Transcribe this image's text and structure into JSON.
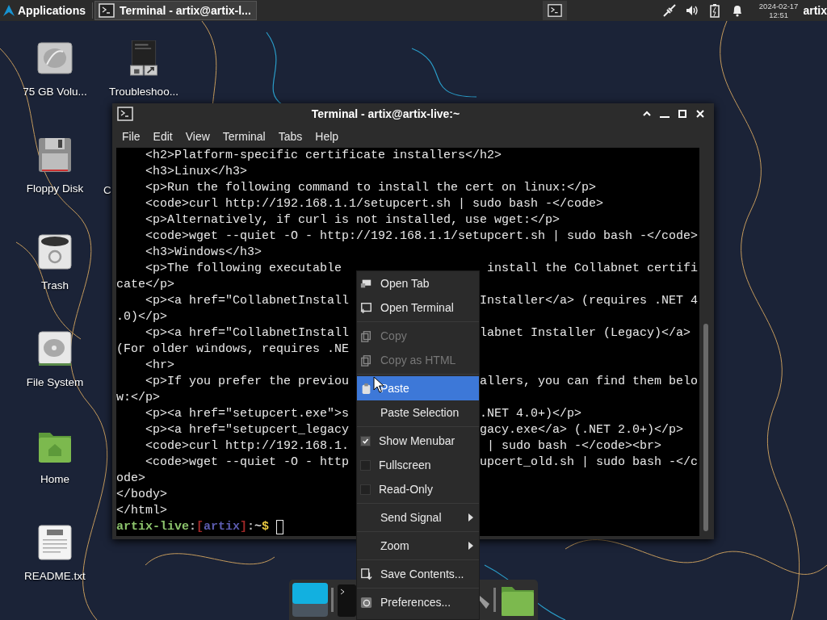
{
  "top_panel": {
    "applications": "Applications",
    "tasks": [
      {
        "title": "Terminal - artix@artix-l...",
        "selected": true
      }
    ],
    "date": "2024-02-17",
    "time": "12:51",
    "user": "artix"
  },
  "desktop_icons": [
    {
      "label": "75 GB Volu...",
      "kind": "drive"
    },
    {
      "label": "Troubleshoo...",
      "kind": "archive"
    },
    {
      "label": "Floppy Disk",
      "kind": "floppy"
    },
    {
      "label": "C",
      "kind": "covered"
    },
    {
      "label": "Trash",
      "kind": "trash"
    },
    {
      "label": "File System",
      "kind": "filesystem"
    },
    {
      "label": "Home",
      "kind": "home"
    },
    {
      "label": "README.txt",
      "kind": "text"
    }
  ],
  "window": {
    "title": "Terminal - artix@artix-live:~",
    "menu": [
      "File",
      "Edit",
      "View",
      "Terminal",
      "Tabs",
      "Help"
    ],
    "lines": [
      {
        "text": "    <h2>Platform-specific certificate installers</h2>"
      },
      {
        "text": "    <h3>Linux</h3>"
      },
      {
        "text": "    <p>Run the following command to install the cert on linux:</p>"
      },
      {
        "text": "    <code>curl http://192.168.1.1/setupcert.sh | sudo bash -</code>"
      },
      {
        "text": "    <p>Alternatively, if curl is not installed, use wget:</p>"
      },
      {
        "text": "    <code>wget --quiet -O - http://192.168.1.1/setupcert.sh | sudo bash -</code>"
      },
      {
        "text": "    <h3>Windows</h3>"
      },
      {
        "text": "    <p>The following executable",
        "right": " install the Collabnet certifi"
      },
      {
        "text": "cate</p>"
      },
      {
        "text": "    <p><a href=\"CollabnetInstall",
        "right": "Installer</a> (requires .NET 4"
      },
      {
        "text": ".0)</p>"
      },
      {
        "text": "    <p><a href=\"CollabnetInstall",
        "right": "labnet Installer (Legacy)</a>"
      },
      {
        "text": "(For older windows, requires .NE"
      },
      {
        "text": "    <hr>"
      },
      {
        "text": "    <p>If you prefer the previou",
        "right": "allers, you can find them belo"
      },
      {
        "text": "w:</p>"
      },
      {
        "text": "    <p><a href=\"setupcert.exe\">s",
        "right": ".NET 4.0+)</p>"
      },
      {
        "text": "    <p><a href=\"setupcert_legacy",
        "right": "gacy.exe</a> (.NET 2.0+)</p>"
      },
      {
        "text": "    <code>curl http://192.168.1.",
        "right": " | sudo bash -</code><br>"
      },
      {
        "text": "    <code>wget --quiet -O - http",
        "right": "upcert_old.sh | sudo bash -</c"
      },
      {
        "text": "ode>"
      },
      {
        "text": "</body>"
      },
      {
        "text": "</html>"
      }
    ],
    "prompt": [
      {
        "text": "artix-live",
        "kind": "host"
      },
      {
        "text": ":",
        "kind": "separator"
      },
      {
        "text": "[",
        "kind": "bracket"
      },
      {
        "text": "artix",
        "kind": "user"
      },
      {
        "text": "]",
        "kind": "bracket"
      },
      {
        "text": ":",
        "kind": "separator"
      },
      {
        "text": "~",
        "kind": "path"
      },
      {
        "text": "$",
        "kind": "symbol"
      }
    ]
  },
  "context_menu": {
    "items": [
      {
        "kind": "action",
        "label": "Open Tab",
        "disabled": false,
        "selected": false
      },
      {
        "kind": "action",
        "label": "Open Terminal",
        "disabled": false,
        "selected": false
      },
      {
        "kind": "separator"
      },
      {
        "kind": "action",
        "label": "Copy",
        "disabled": true,
        "selected": false
      },
      {
        "kind": "action",
        "label": "Copy as HTML",
        "disabled": true,
        "selected": false
      },
      {
        "kind": "separator"
      },
      {
        "kind": "action",
        "label": "Paste",
        "disabled": false,
        "selected": true
      },
      {
        "kind": "action",
        "label": "Paste Selection",
        "disabled": false,
        "selected": false
      },
      {
        "kind": "separator"
      },
      {
        "kind": "check",
        "label": "Show Menubar",
        "checked": true,
        "selected": false
      },
      {
        "kind": "check",
        "label": "Fullscreen",
        "checked": false,
        "selected": false
      },
      {
        "kind": "check",
        "label": "Read-Only",
        "checked": false,
        "selected": false
      },
      {
        "kind": "separator"
      },
      {
        "kind": "submenu",
        "label": "Send Signal",
        "selected": false
      },
      {
        "kind": "separator"
      },
      {
        "kind": "submenu",
        "label": "Zoom",
        "selected": false
      },
      {
        "kind": "separator"
      },
      {
        "kind": "action",
        "label": "Save Contents...",
        "disabled": false,
        "selected": false
      },
      {
        "kind": "separator"
      },
      {
        "kind": "action",
        "label": "Preferences...",
        "disabled": false,
        "selected": false
      }
    ]
  }
}
